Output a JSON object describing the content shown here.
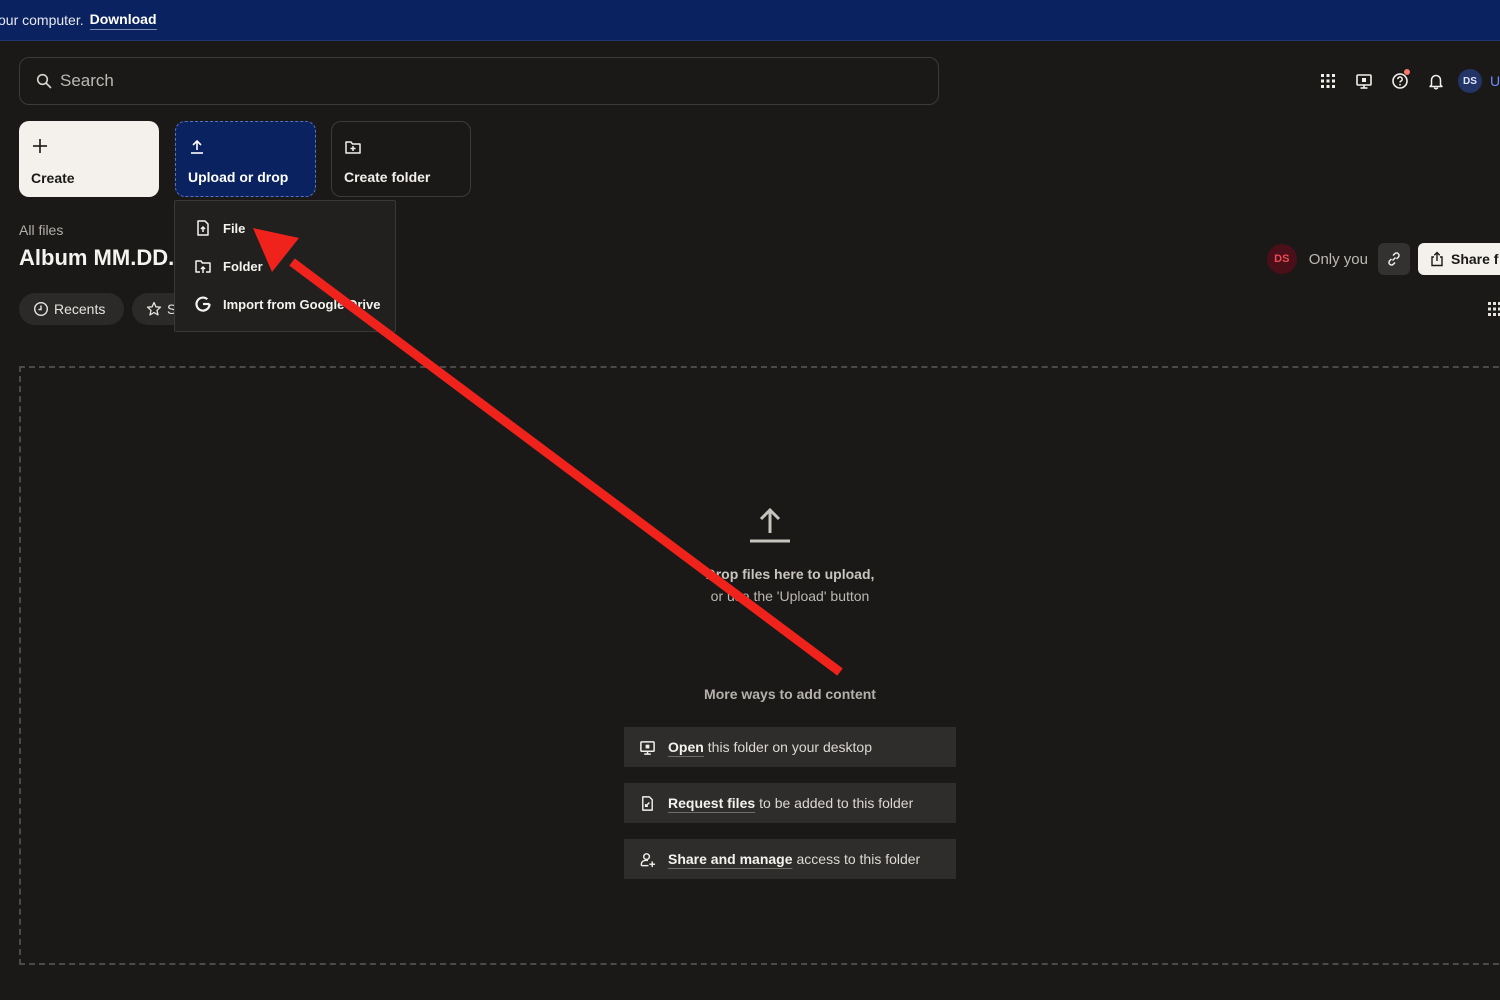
{
  "banner": {
    "message": "our computer.",
    "download_link": "Download"
  },
  "search": {
    "placeholder": "Search"
  },
  "top_icons": [
    {
      "name": "apps-grid-icon"
    },
    {
      "name": "desktop-app-icon"
    },
    {
      "name": "help-icon",
      "has_notification_dot": true
    },
    {
      "name": "notifications-bell-icon"
    }
  ],
  "user": {
    "initials": "DS",
    "avatar_color": "#233567"
  },
  "actions": {
    "create": "Create",
    "upload": "Upload or drop",
    "create_folder": "Create folder"
  },
  "upload_menu": {
    "items": [
      {
        "label": "File",
        "icon": "file-upload-icon"
      },
      {
        "label": "Folder",
        "icon": "folder-upload-icon"
      },
      {
        "label": "Import from Google Drive",
        "icon": "google-icon"
      }
    ]
  },
  "breadcrumb": "All files",
  "folder_title": "Album MM.DD.",
  "filters": {
    "recents": "Recents",
    "starred": "S"
  },
  "sharing": {
    "owner_initials": "DS",
    "owner_color": "#ec4b55",
    "visibility": "Only you",
    "share_label": "Share f"
  },
  "dropzone": {
    "line1": "Drop files here to upload,",
    "line2": "or use the 'Upload' button",
    "more_heading": "More ways to add content",
    "ways": [
      {
        "bold": "Open",
        "rest": "this folder on your desktop",
        "icon": "desktop-icon"
      },
      {
        "bold": "Request files",
        "rest": "to be added to this folder",
        "icon": "file-request-icon"
      },
      {
        "bold": "Share and manage",
        "rest": "access to this folder",
        "icon": "person-add-icon"
      }
    ]
  },
  "annotation": {
    "type": "arrow",
    "color": "#f0231c",
    "points_to": "File menu item"
  },
  "colors": {
    "background": "#1a1918",
    "banner": "#0b2260",
    "accent_primary": "#0b2260"
  }
}
